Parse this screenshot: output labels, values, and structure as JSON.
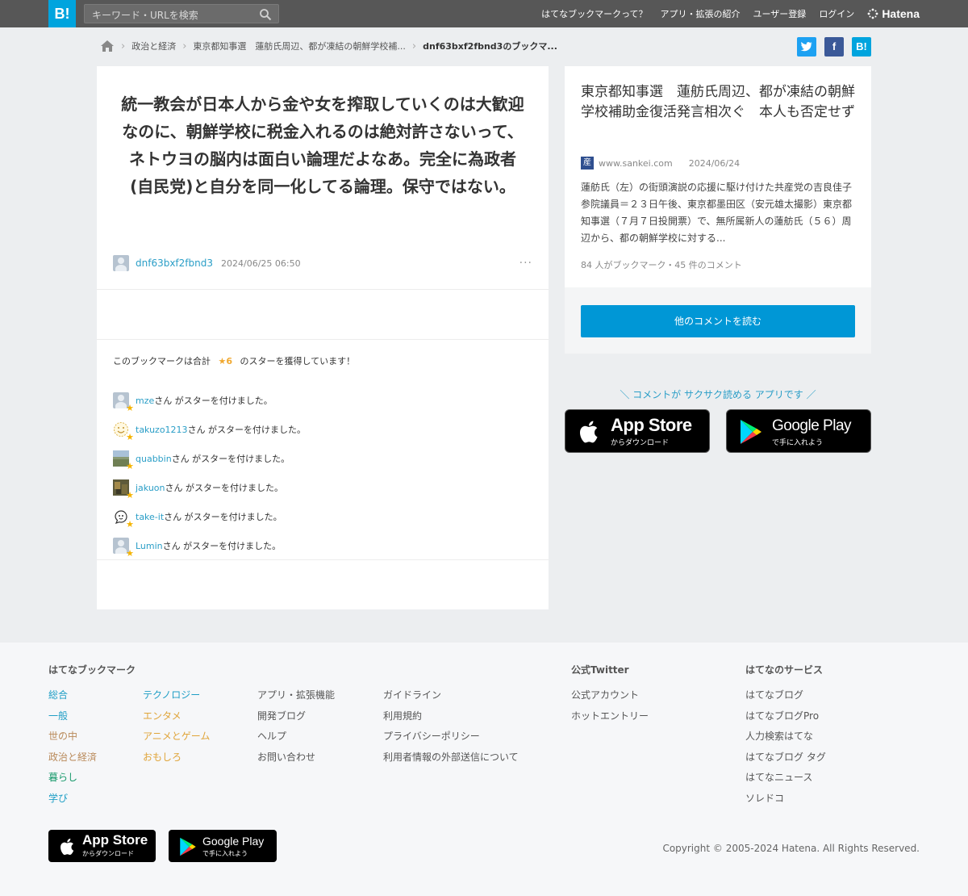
{
  "topbar": {
    "logo": "B!",
    "search_placeholder": "キーワード・URLを検索",
    "nav": [
      "はてなブックマークって？",
      "アプリ・拡張の紹介",
      "ユーザー登録",
      "ログイン"
    ],
    "brand": "Hatena"
  },
  "breadcrumb": {
    "items": [
      "政治と経済",
      "東京都知事選　蓮舫氏周辺、都が凍結の朝鮮学校補...",
      "dnf63bxf2fbnd3のブックマ..."
    ]
  },
  "share": {
    "twitter": "t",
    "facebook": "f",
    "hatebu": "B!"
  },
  "comment": {
    "text": "統一教会が日本人から金や女を搾取していくのは大歓迎なのに、朝鮮学校に税金入れるのは絶対許さないって、ネトウヨの脳内は面白い論理だよなあ。完全に為政者(自民党)と自分を同一化してる論理。保守ではない。",
    "user": "dnf63bxf2fbnd3",
    "date": "2024/06/25 06:50",
    "more": "…"
  },
  "stars": {
    "summary_prefix": "このブックマークは合計",
    "summary_count": "★6",
    "summary_suffix": "のスターを獲得しています！",
    "suffix": "さん がスターを付けました。",
    "users": [
      "mze",
      "takuzo1213",
      "quabbin",
      "jakuon",
      "take-it",
      "Lumin"
    ]
  },
  "entry": {
    "title": "東京都知事選　蓮舫氏周辺、都が凍結の朝鮮学校補助金復活発言相次ぐ　本人も否定せず",
    "favicon": "産",
    "domain": "www.sankei.com",
    "date": "2024/06/24",
    "description": "蓮舫氏（左）の街頭演説の応援に駆け付けた共産党の吉良佳子参院議員＝２３日午後、東京都墨田区（安元雄太撮影）東京都知事選（７月７日投開票）で、無所属新人の蓮舫氏（５６）周辺から、都の朝鮮学校に対する...",
    "count": "84 人がブックマーク・45 件のコメント"
  },
  "more_comments": "他のコメントを読む",
  "app_promo": "＼ コメントが サクサク読める アプリです ／",
  "stores": {
    "appstore": {
      "big": "App Store",
      "small": "からダウンロード"
    },
    "googleplay": {
      "big": "Google Play",
      "small": "で手に入れよう"
    }
  },
  "footer": {
    "col1_head": "はてなブックマーク",
    "categories_a": [
      "総合",
      "一般",
      "世の中",
      "政治と経済",
      "暮らし",
      "学び"
    ],
    "categories_b": [
      "テクノロジー",
      "エンタメ",
      "アニメとゲーム",
      "おもしろ"
    ],
    "links_c": [
      "アプリ・拡張機能",
      "開発ブログ",
      "ヘルプ",
      "お問い合わせ"
    ],
    "links_d": [
      "ガイドライン",
      "利用規約",
      "プライバシーポリシー",
      "利用者情報の外部送信について"
    ],
    "twitter_head": "公式Twitter",
    "twitter_links": [
      "公式アカウント",
      "ホットエントリー"
    ],
    "services_head": "はてなのサービス",
    "services": [
      "はてなブログ",
      "はてなブログPro",
      "人力検索はてな",
      "はてなブログ タグ",
      "はてなニュース",
      "ソレドコ"
    ],
    "copyright": "Copyright © 2005-2024 Hatena. All Rights Reserved."
  },
  "colors": {
    "accent": "#00a4de",
    "button": "#0097d6",
    "star": "#f5b400",
    "link": "#2a9ec7"
  }
}
